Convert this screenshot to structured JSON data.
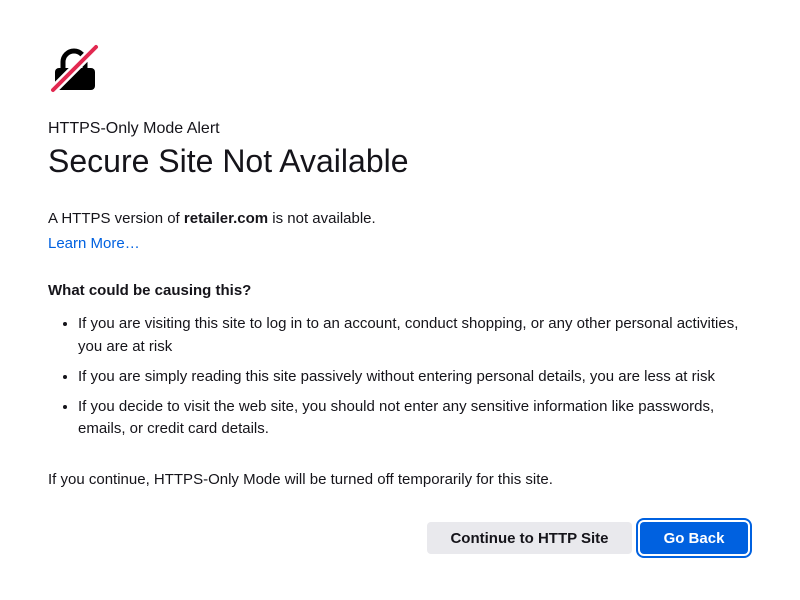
{
  "icon": {
    "name": "broken-lock-icon",
    "lock_color": "#000000",
    "slash_color": "#e22850"
  },
  "header": {
    "subtitle": "HTTPS-Only Mode Alert",
    "title": "Secure Site Not Available"
  },
  "intro": {
    "prefix": "A HTTPS version of ",
    "domain": "retailer.com",
    "suffix": " is not available."
  },
  "learn_more_label": "Learn More…",
  "causes": {
    "heading": "What could be causing this?",
    "items": [
      "If you are visiting this site to log in to an account, conduct shopping, or any other personal activities, you are at risk",
      "If you are simply reading this site passively without entering personal details, you are less at risk",
      "If you decide to visit the web site, you should not enter any sensitive information like passwords, emails, or credit card details."
    ]
  },
  "continue_note": "If you continue, HTTPS-Only Mode will be turned off temporarily for this site.",
  "buttons": {
    "continue_label": "Continue to HTTP Site",
    "go_back_label": "Go Back"
  },
  "colors": {
    "accent": "#0061e0",
    "secondary_button": "#e9e9ed",
    "text": "#15141a"
  }
}
